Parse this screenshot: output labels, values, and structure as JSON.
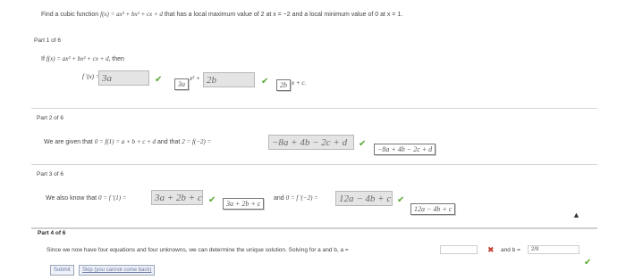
{
  "problem": {
    "prefix": "Find a cubic function ",
    "fx": "f(x) = ax³ + bx² + cx + d",
    "suffix": " that has a local maximum value of 2 at x = −2 and a local minimum value of 0 at x = 1."
  },
  "part1": {
    "title": "Part 1 of 6",
    "if_line_a": "If ",
    "if_line_fx": "f(x) = ax³ + bx² + cx + d,",
    "if_line_then": " then",
    "deriv_label": "f '(x) = ",
    "input1_value": "3a",
    "answer1": "3a",
    "x2_plus": "x² + ",
    "input2_value": "2b",
    "answer2": "2b",
    "x_plus_c": "x + c."
  },
  "part2": {
    "title": "Part 2 of 6",
    "text_a": "We are given that ",
    "eq1": "0 = f(1) = a + b + c + d",
    "text_and": " and that ",
    "eq2": "2 = f(−2) = ",
    "input_value": "−8a + 4b − 2c + d",
    "answer": "−8a + 4b − 2c + d"
  },
  "part3": {
    "title": "Part 3 of 6",
    "text_a": "We also know that ",
    "eq1": "0 = f '(1) = ",
    "input1_value": "3a + 2b + c",
    "answer1": "3a + 2b + c",
    "text_and": " and ",
    "eq2": "0 = f '(−2) = ",
    "input2_value": "12a − 4b + c",
    "answer2": "12a − 4b + c"
  },
  "part4": {
    "title": "Part 4 of 6",
    "text": "Since we now have four equations and four unknowns, we can determine the unique solution. Solving for a and b, a = ",
    "a_value": "",
    "and_b": "and b = ",
    "b_value": "2/9",
    "submit_label": "Submit",
    "skip_label": "Skip (you cannot come back)"
  },
  "colors": {
    "check": "#58a832",
    "cross": "#c0392b",
    "input_fill": "#e4e4e4"
  }
}
